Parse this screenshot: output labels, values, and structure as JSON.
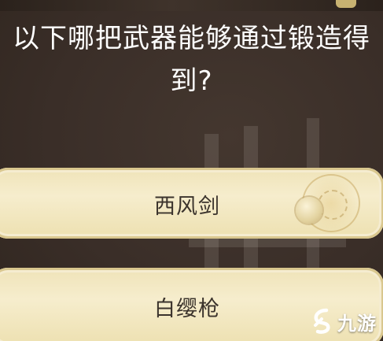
{
  "question": {
    "line1": "以下哪把武器能够通过锻造得",
    "line2": "到?"
  },
  "options": [
    {
      "label": "西风剑"
    },
    {
      "label": "白缨枪"
    }
  ],
  "watermark": {
    "logo_text": "九游"
  },
  "colors": {
    "background": "#3a2f2a",
    "option_fill": "#f3e8c4",
    "option_text": "#3b332c",
    "question_text": "#ffffff"
  }
}
